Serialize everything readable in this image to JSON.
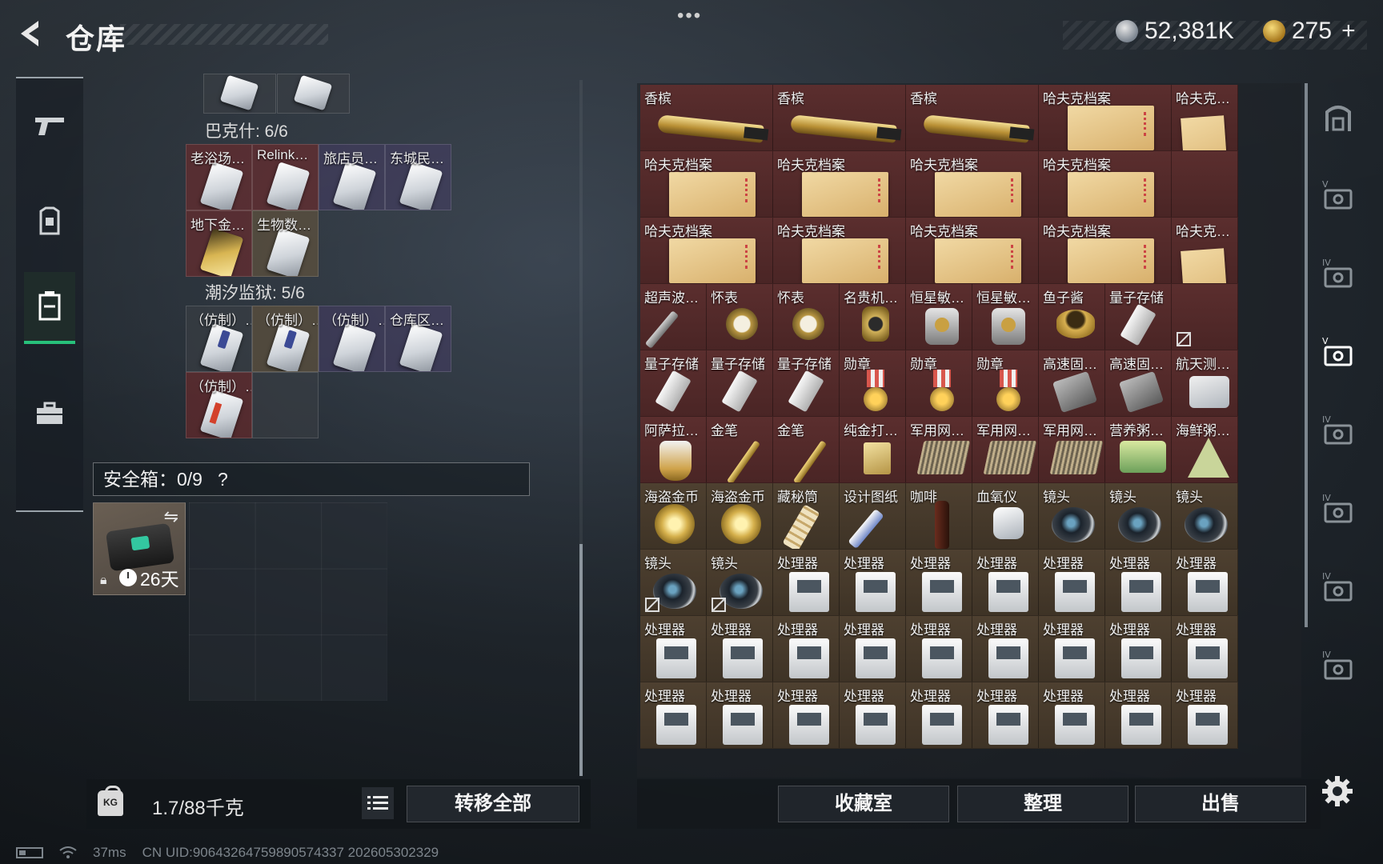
{
  "header": {
    "title": "仓库",
    "menu_dots": "•••",
    "currency": {
      "silver": "52,381K",
      "gold": "275",
      "plus": "+"
    }
  },
  "left_nav": {
    "items": [
      {
        "name": "weapon-nav",
        "icon": "pistol-icon"
      },
      {
        "name": "gear-nav",
        "icon": "vest-icon"
      },
      {
        "name": "container-nav",
        "icon": "container-icon",
        "active": true
      },
      {
        "name": "case-nav",
        "icon": "briefcase-icon"
      }
    ]
  },
  "equipped": {
    "top_partial_slots": 2,
    "sections": [
      {
        "label": "巴克什: 6/6",
        "slots": [
          {
            "label": "老浴场…",
            "bg": "red",
            "card": "silver"
          },
          {
            "label": "Relink…",
            "bg": "red",
            "card": "silver"
          },
          {
            "label": "旅店员…",
            "bg": "purple",
            "card": "silver"
          },
          {
            "label": "东城民…",
            "bg": "purple",
            "card": "silver"
          },
          {
            "label": "地下金…",
            "bg": "red",
            "card": "gold"
          },
          {
            "label": "生物数…",
            "bg": "gold",
            "card": "silver"
          }
        ]
      },
      {
        "label": "潮汐监狱: 5/6",
        "slots": [
          {
            "label": "（仿制）…",
            "bg": "gray",
            "card": "bluet"
          },
          {
            "label": "（仿制）…",
            "bg": "gold",
            "card": "bluet"
          },
          {
            "label": "（仿制）…",
            "bg": "purple",
            "card": "silver"
          },
          {
            "label": "仓库区…",
            "bg": "purple",
            "card": "silver"
          },
          {
            "label": "（仿制）…",
            "bg": "red",
            "card": "redt"
          },
          {
            "label": "",
            "bg": "empty",
            "card": ""
          }
        ]
      }
    ],
    "safe": {
      "label": "安全箱：0/9",
      "help": "?",
      "days": "26天"
    }
  },
  "bottom_left": {
    "weight_icon_text": "KG",
    "weight": "1.7/88千克",
    "transfer_all": "转移全部"
  },
  "warehouse": {
    "rows": [
      [
        {
          "label": "香槟",
          "icon": "bottle",
          "bg": "red",
          "span": 2
        },
        {
          "label": "香槟",
          "icon": "bottle",
          "bg": "red",
          "span": 2
        },
        {
          "label": "香槟",
          "icon": "bottle",
          "bg": "red",
          "span": 2
        },
        {
          "label": "哈夫克档案",
          "icon": "folder",
          "bg": "red",
          "span": 2
        },
        {
          "label": "哈夫克…",
          "icon": "folder-tall",
          "bg": "red",
          "span": 1
        }
      ],
      [
        {
          "label": "哈夫克档案",
          "icon": "folder",
          "bg": "red",
          "span": 2
        },
        {
          "label": "哈夫克档案",
          "icon": "folder",
          "bg": "red",
          "span": 2
        },
        {
          "label": "哈夫克档案",
          "icon": "folder",
          "bg": "red",
          "span": 2
        },
        {
          "label": "哈夫克档案",
          "icon": "folder",
          "bg": "red",
          "span": 2
        },
        {
          "label": "",
          "icon": "",
          "bg": "red",
          "span": 1
        }
      ],
      [
        {
          "label": "哈夫克档案",
          "icon": "folder",
          "bg": "red",
          "span": 2
        },
        {
          "label": "哈夫克档案",
          "icon": "folder",
          "bg": "red",
          "span": 2
        },
        {
          "label": "哈夫克档案",
          "icon": "folder",
          "bg": "red",
          "span": 2
        },
        {
          "label": "哈夫克档案",
          "icon": "folder",
          "bg": "red",
          "span": 2
        },
        {
          "label": "哈夫克…",
          "icon": "folder-tall",
          "bg": "red",
          "span": 1
        }
      ],
      [
        {
          "label": "超声波…",
          "icon": "knife",
          "bg": "red"
        },
        {
          "label": "怀表",
          "icon": "watch",
          "bg": "red"
        },
        {
          "label": "怀表",
          "icon": "watch",
          "bg": "red"
        },
        {
          "label": "名贵机…",
          "icon": "lux",
          "bg": "red"
        },
        {
          "label": "恒星敏…",
          "icon": "star",
          "bg": "red"
        },
        {
          "label": "恒星敏…",
          "icon": "star",
          "bg": "red"
        },
        {
          "label": "鱼子酱",
          "icon": "caviar",
          "bg": "red"
        },
        {
          "label": "量子存储",
          "icon": "usb",
          "bg": "red"
        },
        {
          "label": "",
          "icon": "",
          "bg": "red",
          "mark": true
        }
      ],
      [
        {
          "label": "量子存储",
          "icon": "usb",
          "bg": "red"
        },
        {
          "label": "量子存储",
          "icon": "usb",
          "bg": "red"
        },
        {
          "label": "量子存储",
          "icon": "usb",
          "bg": "red"
        },
        {
          "label": "勋章",
          "icon": "medal",
          "bg": "red"
        },
        {
          "label": "勋章",
          "icon": "medal",
          "bg": "red"
        },
        {
          "label": "勋章",
          "icon": "medal",
          "bg": "red"
        },
        {
          "label": "高速固…",
          "icon": "drive",
          "bg": "red"
        },
        {
          "label": "高速固…",
          "icon": "drive",
          "bg": "red"
        },
        {
          "label": "航天测…",
          "icon": "disk",
          "bg": "red"
        }
      ],
      [
        {
          "label": "阿萨拉…",
          "icon": "cup",
          "bg": "red"
        },
        {
          "label": "金笔",
          "icon": "pen",
          "bg": "red"
        },
        {
          "label": "金笔",
          "icon": "pen",
          "bg": "red"
        },
        {
          "label": "纯金打…",
          "icon": "lighter",
          "bg": "red"
        },
        {
          "label": "军用网…",
          "icon": "net",
          "bg": "red"
        },
        {
          "label": "军用网…",
          "icon": "net",
          "bg": "red"
        },
        {
          "label": "军用网…",
          "icon": "net",
          "bg": "red"
        },
        {
          "label": "营养粥…",
          "icon": "tin",
          "bg": "red"
        },
        {
          "label": "海鲜粥…",
          "icon": "tri",
          "bg": "red"
        }
      ],
      [
        {
          "label": "海盗金币",
          "icon": "coin",
          "bg": "gold"
        },
        {
          "label": "海盗金币",
          "icon": "coin",
          "bg": "gold"
        },
        {
          "label": "藏秘筒",
          "icon": "scroll",
          "bg": "gold"
        },
        {
          "label": "设计图纸",
          "icon": "tube",
          "bg": "gold"
        },
        {
          "label": "咖啡",
          "icon": "bottle-brown",
          "bg": "gold"
        },
        {
          "label": "血氧仪",
          "icon": "oxy",
          "bg": "gold"
        },
        {
          "label": "镜头",
          "icon": "lens",
          "bg": "gold"
        },
        {
          "label": "镜头",
          "icon": "lens",
          "bg": "gold"
        },
        {
          "label": "镜头",
          "icon": "lens",
          "bg": "gold"
        }
      ],
      [
        {
          "label": "镜头",
          "icon": "lens",
          "bg": "gold",
          "mark": true
        },
        {
          "label": "镜头",
          "icon": "lens",
          "bg": "gold",
          "mark": true
        },
        {
          "label": "处理器",
          "icon": "cpu",
          "bg": "gold"
        },
        {
          "label": "处理器",
          "icon": "cpu",
          "bg": "gold"
        },
        {
          "label": "处理器",
          "icon": "cpu",
          "bg": "gold"
        },
        {
          "label": "处理器",
          "icon": "cpu",
          "bg": "gold"
        },
        {
          "label": "处理器",
          "icon": "cpu",
          "bg": "gold"
        },
        {
          "label": "处理器",
          "icon": "cpu",
          "bg": "gold"
        },
        {
          "label": "处理器",
          "icon": "cpu",
          "bg": "gold"
        }
      ],
      [
        {
          "label": "处理器",
          "icon": "cpu",
          "bg": "gold"
        },
        {
          "label": "处理器",
          "icon": "cpu",
          "bg": "gold"
        },
        {
          "label": "处理器",
          "icon": "cpu",
          "bg": "gold"
        },
        {
          "label": "处理器",
          "icon": "cpu",
          "bg": "gold"
        },
        {
          "label": "处理器",
          "icon": "cpu",
          "bg": "gold"
        },
        {
          "label": "处理器",
          "icon": "cpu",
          "bg": "gold"
        },
        {
          "label": "处理器",
          "icon": "cpu",
          "bg": "gold"
        },
        {
          "label": "处理器",
          "icon": "cpu",
          "bg": "gold"
        },
        {
          "label": "处理器",
          "icon": "cpu",
          "bg": "gold"
        }
      ],
      [
        {
          "label": "处理器",
          "icon": "cpu",
          "bg": "gold"
        },
        {
          "label": "处理器",
          "icon": "cpu",
          "bg": "gold"
        },
        {
          "label": "处理器",
          "icon": "cpu",
          "bg": "gold"
        },
        {
          "label": "处理器",
          "icon": "cpu",
          "bg": "gold"
        },
        {
          "label": "处理器",
          "icon": "cpu",
          "bg": "gold"
        },
        {
          "label": "处理器",
          "icon": "cpu",
          "bg": "gold"
        },
        {
          "label": "处理器",
          "icon": "cpu",
          "bg": "gold"
        },
        {
          "label": "处理器",
          "icon": "cpu",
          "bg": "gold"
        },
        {
          "label": "处理器",
          "icon": "cpu",
          "bg": "gold"
        }
      ]
    ]
  },
  "right_bar": {
    "items": [
      {
        "name": "storage-tab-main",
        "tier": ""
      },
      {
        "name": "storage-tab-v1",
        "tier": "V"
      },
      {
        "name": "storage-tab-iv1",
        "tier": "IV"
      },
      {
        "name": "storage-tab-v2",
        "tier": "V",
        "active": true
      },
      {
        "name": "storage-tab-iv2",
        "tier": "IV"
      },
      {
        "name": "storage-tab-iv3",
        "tier": "IV"
      },
      {
        "name": "storage-tab-iv4",
        "tier": "IV"
      },
      {
        "name": "storage-tab-iv5",
        "tier": "IV"
      }
    ]
  },
  "bottom_right": {
    "collection": "收藏室",
    "organize": "整理",
    "sell": "出售"
  },
  "status": {
    "ping": "37ms",
    "uid": "CN UID:9064326475989057433​7 202605302329"
  }
}
